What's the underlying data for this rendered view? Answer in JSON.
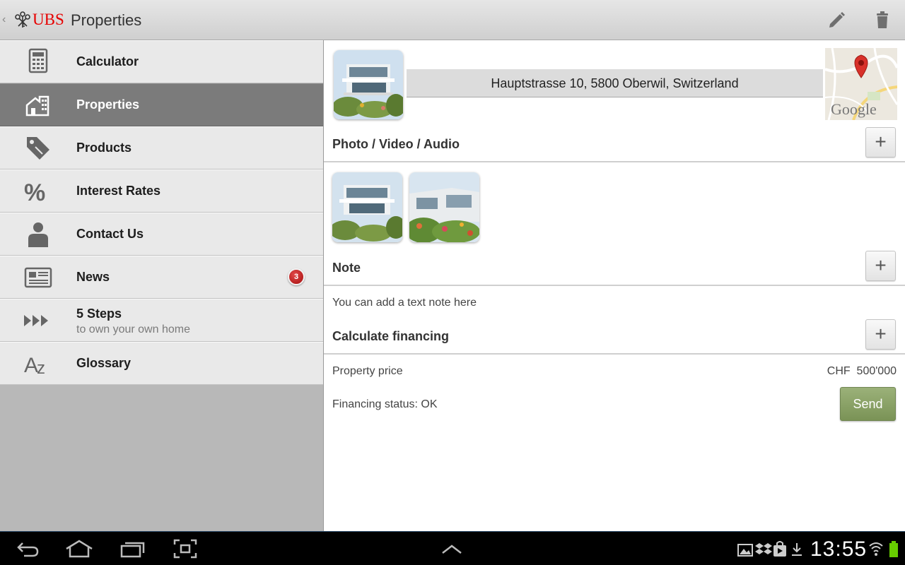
{
  "header": {
    "brand": "UBS",
    "title": "Properties",
    "icons": {
      "back": "back-chevron-icon",
      "logo": "ubs-keys-logo",
      "edit": "pencil-icon",
      "delete": "trash-icon"
    }
  },
  "sidebar": {
    "items": [
      {
        "label": "Calculator",
        "icon": "calculator-icon"
      },
      {
        "label": "Properties",
        "icon": "house-icon",
        "active": true
      },
      {
        "label": "Products",
        "icon": "price-tag-icon"
      },
      {
        "label": "Interest Rates",
        "icon": "percent-icon"
      },
      {
        "label": "Contact Us",
        "icon": "person-icon"
      },
      {
        "label": "News",
        "icon": "newspaper-icon",
        "badge": "3"
      },
      {
        "label": "5 Steps",
        "sublabel": "to own your own home",
        "icon": "fast-forward-icon"
      },
      {
        "label": "Glossary",
        "icon": "az-icon"
      }
    ]
  },
  "property": {
    "address": "Hauptstrasse 10, 5800 Oberwil, Switzerland",
    "map_label": "Google"
  },
  "sections": {
    "media": {
      "title": "Photo / Video / Audio"
    },
    "note": {
      "title": "Note",
      "text": "You can add a text note here"
    },
    "financing": {
      "title": "Calculate financing",
      "price_label": "Property price",
      "price_value": "CHF  500'000",
      "status_label": "Financing status: OK",
      "send_label": "Send"
    }
  },
  "system_bar": {
    "clock": "13:55",
    "battery_color": "#66cc00"
  },
  "colors": {
    "brand_red": "#e60000",
    "active_nav": "#7b7b7b",
    "send_button": "#8aa366",
    "badge": "#c01818"
  }
}
